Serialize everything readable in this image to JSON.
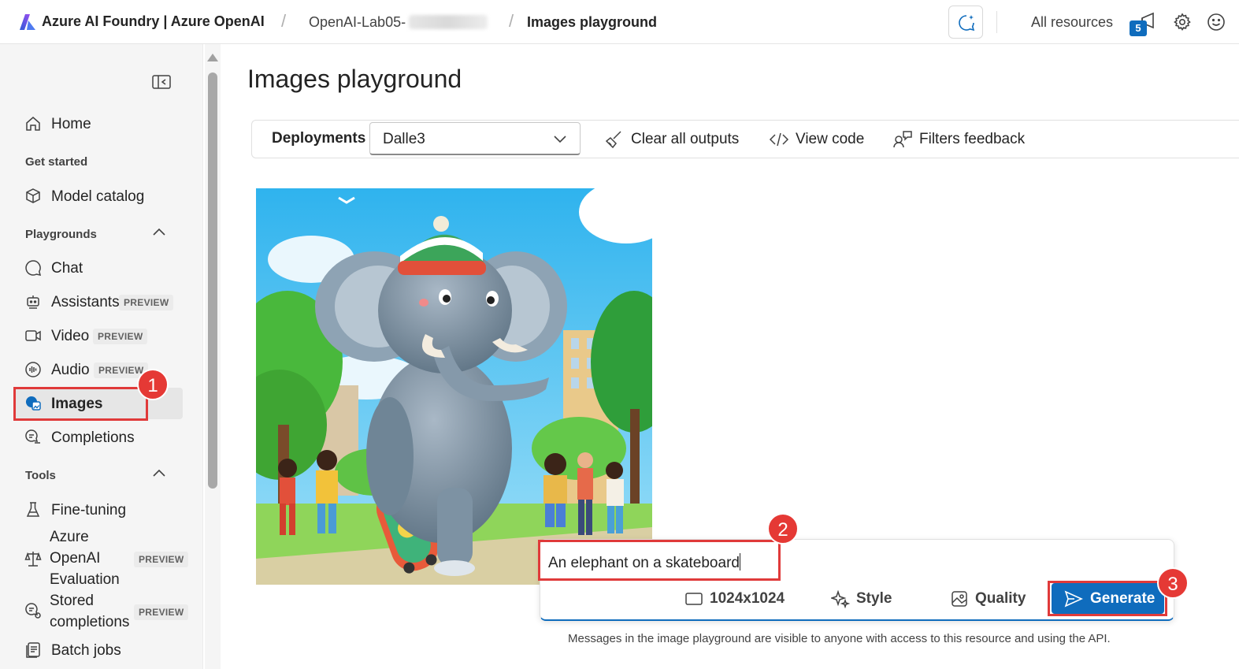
{
  "header": {
    "brand": "Azure AI Foundry | Azure OpenAI",
    "breadcrumb_project": "OpenAI-Lab05-",
    "breadcrumb_current": "Images playground",
    "all_resources": "All resources",
    "notification_count": "5"
  },
  "sidebar": {
    "home": "Home",
    "section_get_started": "Get started",
    "model_catalog": "Model catalog",
    "section_playgrounds": "Playgrounds",
    "chat": "Chat",
    "assistants": "Assistants",
    "video": "Video",
    "audio": "Audio",
    "images": "Images",
    "completions": "Completions",
    "section_tools": "Tools",
    "fine_tuning": "Fine-tuning",
    "eval_line1": "Azure",
    "eval_line2": "OpenAI",
    "eval_line3": "Evaluation",
    "stored_line1": "Stored",
    "stored_line2": "completions",
    "batch_jobs": "Batch jobs",
    "preview_tag": "PREVIEW"
  },
  "main": {
    "title": "Images playground",
    "deployments_label": "Deployments",
    "deployment_value": "Dalle3",
    "clear_outputs": "Clear all outputs",
    "view_code": "View code",
    "filters_feedback": "Filters feedback"
  },
  "prompt": {
    "value": "An elephant on a skateboard",
    "size": "1024x1024",
    "style": "Style",
    "quality": "Quality",
    "generate": "Generate",
    "disclaimer": "Messages in the image playground are visible to anyone with access to this resource and using the API."
  },
  "annotations": {
    "step1": "1",
    "step2": "2",
    "step3": "3"
  },
  "colors": {
    "accent": "#0f6cbd",
    "annotation_red": "#e03a3a"
  }
}
